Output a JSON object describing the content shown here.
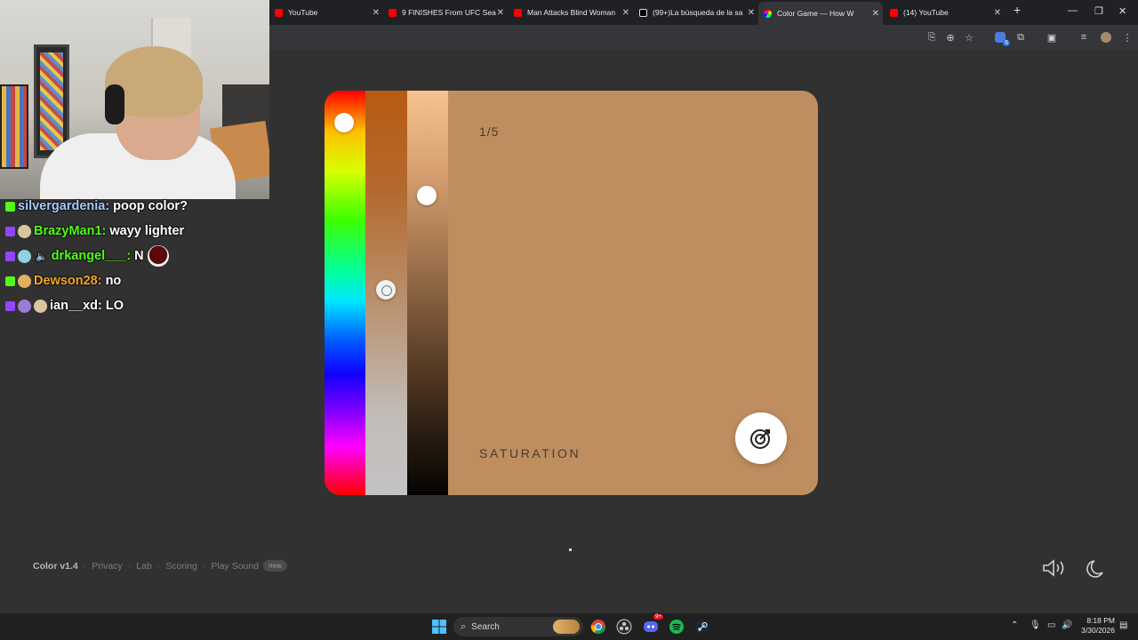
{
  "browser": {
    "tabs": [
      {
        "title": "YouTube",
        "favicon_color": "#ff0000"
      },
      {
        "title": "9 FINISHES From UFC Sea",
        "favicon_color": "#ff0000"
      },
      {
        "title": "Man Attacks Blind Woman",
        "favicon_color": "#ff0000"
      },
      {
        "title": "(99+)La búsqueda de la sa",
        "favicon_color": "#000000"
      },
      {
        "title": "Color Game — How W",
        "favicon_color": "#8ad0ff",
        "active": true
      },
      {
        "title": "(14) YouTube",
        "favicon_color": "#ff0000"
      }
    ],
    "new_tab_label": "+",
    "window_controls": {
      "minimize": "—",
      "restore": "❐",
      "close": "✕"
    },
    "toolbar_icons": [
      "install-icon",
      "zoom-icon",
      "bookmark-star-icon",
      "extension-badge-icon",
      "extensions-icon",
      "sidebar-icon",
      "media-icon",
      "profile-icon",
      "menu-icon"
    ],
    "extension_badge": "6"
  },
  "game": {
    "round": "1/5",
    "mode_label": "SATURATION",
    "card_color": "#be8e60",
    "submit_icon": "target-check-icon"
  },
  "footer": {
    "brand": "Color v1.4",
    "links": [
      "Privacy",
      "Lab",
      "Scoring",
      "Play Sound"
    ],
    "new_badge": "new",
    "sound_icon": "speaker-icon",
    "theme_icon": "moon-icon"
  },
  "chat": [
    {
      "badge": "k",
      "user": "silvergardenia:",
      "user_color": "#a8c8ff",
      "text": "poop color?"
    },
    {
      "badge": "t",
      "user": "BrazyMan1:",
      "user_color": "#53fc18",
      "text": "wayy lighter"
    },
    {
      "badge": "t",
      "user": "drkangel___:",
      "user_color": "#53fc18",
      "text": "N"
    },
    {
      "badge": "k",
      "user": "Dewson28:",
      "user_color": "#f5a623",
      "text": "no"
    },
    {
      "badge": "t",
      "user": "ian__xd:",
      "user_color": "#ffffff",
      "text": "LO"
    }
  ],
  "taskbar": {
    "search_label": "Search",
    "time": "8:18 PM",
    "date": "3/30/2026",
    "chat_badge": "9+",
    "apps": [
      "windows-start-icon",
      "chrome-icon",
      "obs-icon",
      "discord-icon",
      "spotify-icon",
      "steam-icon"
    ]
  }
}
